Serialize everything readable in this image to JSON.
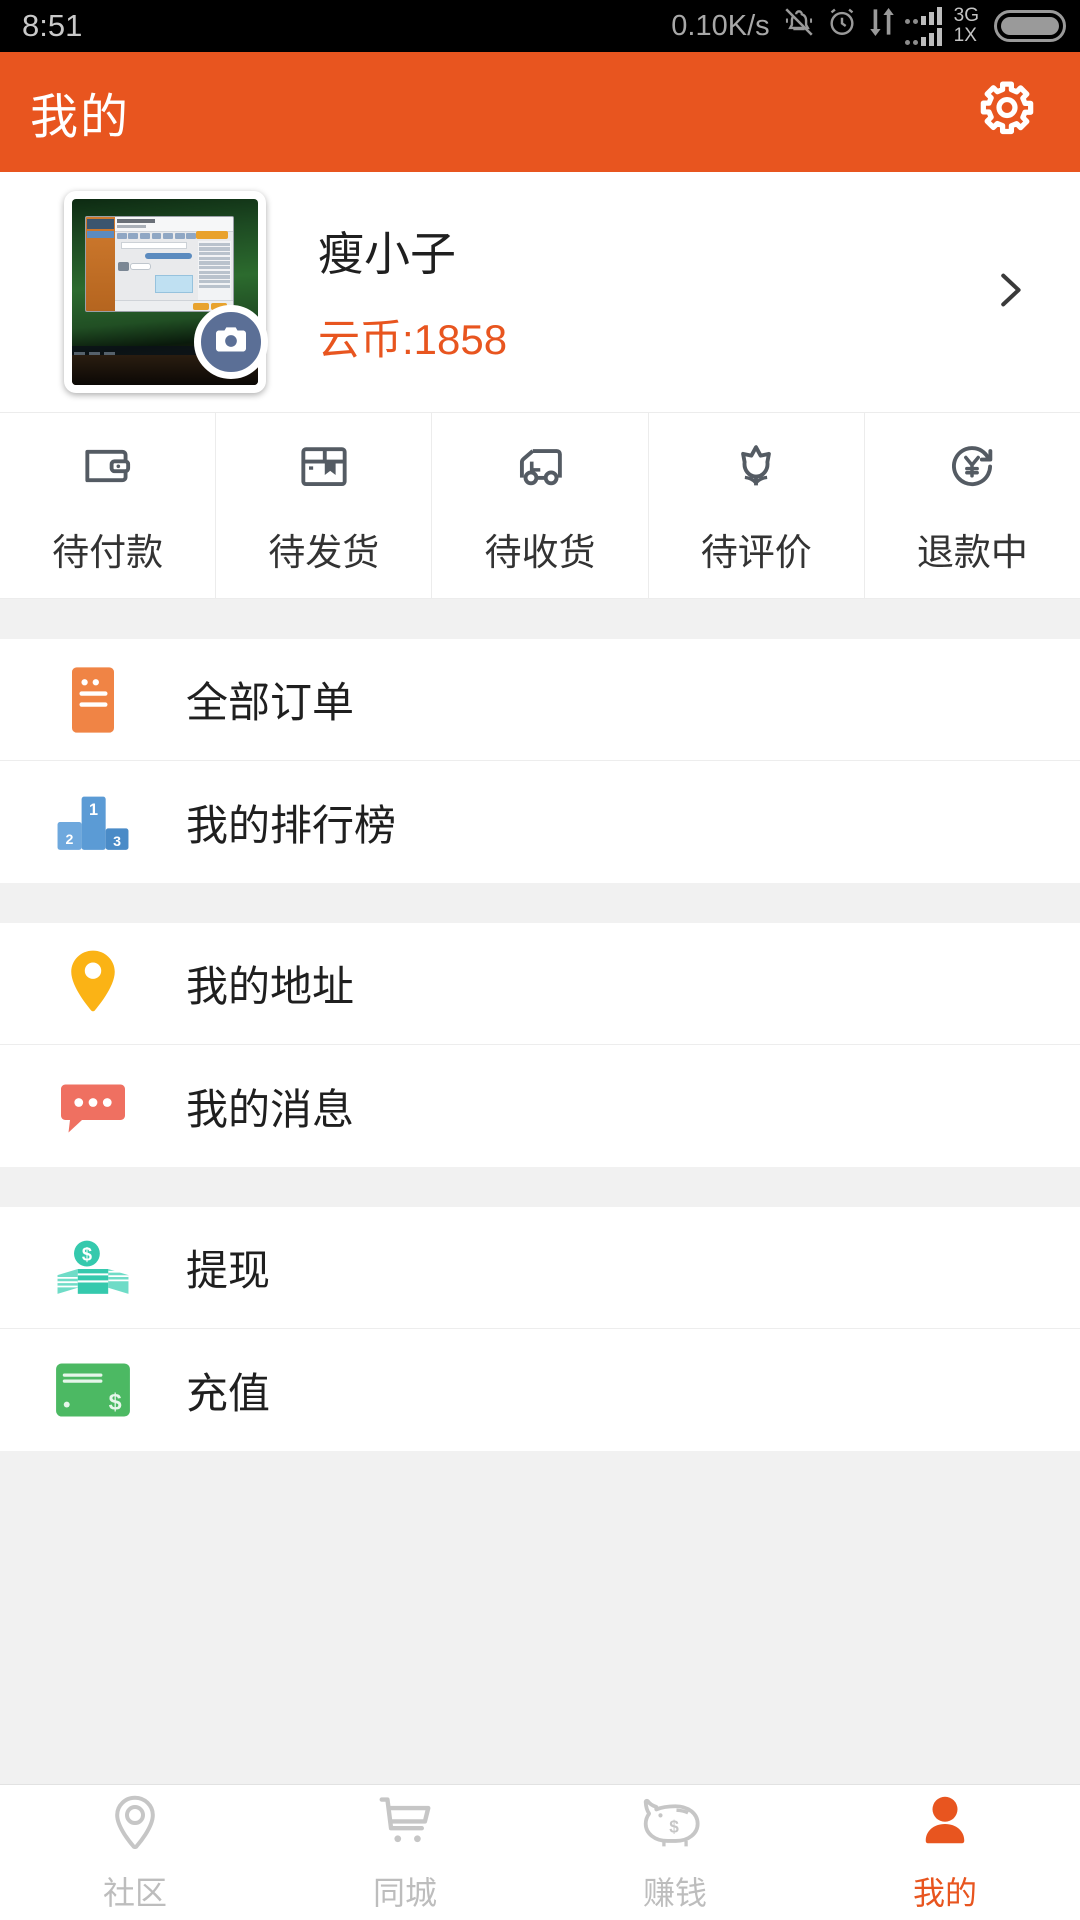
{
  "status_bar": {
    "time": "8:51",
    "network_speed": "0.10K/s",
    "icons": [
      "bell-muted-icon",
      "alarm-clock-icon",
      "data-transfer-icon",
      "signal-bars-icon",
      "battery-icon"
    ],
    "signal_label_top": "3G",
    "signal_label_bottom": "1X"
  },
  "header": {
    "title": "我的",
    "settings_icon": "gear-icon",
    "background_color": "#e8551f"
  },
  "profile": {
    "avatar_icon": "user-avatar-photo",
    "camera_badge_icon": "camera-icon",
    "username": "瘦小子",
    "coin_label": "云币:1858",
    "coin_color": "#e8551f",
    "chevron_icon": "chevron-right-icon"
  },
  "order_status": [
    {
      "label": "待付款",
      "icon": "wallet-icon"
    },
    {
      "label": "待发货",
      "icon": "package-box-icon"
    },
    {
      "label": "待收货",
      "icon": "delivery-truck-icon"
    },
    {
      "label": "待评价",
      "icon": "flower-icon"
    },
    {
      "label": "退款中",
      "icon": "refund-yuan-icon"
    }
  ],
  "menu_groups": [
    {
      "items": [
        {
          "label": "全部订单",
          "icon": "order-document-icon",
          "color": "#f08445"
        },
        {
          "label": "我的排行榜",
          "icon": "podium-ranking-icon",
          "color": "#5b9bd5"
        }
      ]
    },
    {
      "items": [
        {
          "label": "我的地址",
          "icon": "location-pin-icon",
          "color": "#fbb315"
        },
        {
          "label": "我的消息",
          "icon": "message-bubble-icon",
          "color": "#ef7061"
        }
      ]
    },
    {
      "items": [
        {
          "label": "提现",
          "icon": "cash-stack-icon",
          "color": "#35c9ad"
        },
        {
          "label": "充值",
          "icon": "credit-card-icon",
          "color": "#4cb963"
        }
      ]
    }
  ],
  "bottom_nav": {
    "active_color": "#e8551f",
    "inactive_color": "#bdbdbd",
    "items": [
      {
        "label": "社区",
        "icon": "location-pin-outline-icon",
        "active": false
      },
      {
        "label": "同城",
        "icon": "shopping-cart-icon",
        "active": false
      },
      {
        "label": "赚钱",
        "icon": "piggy-bank-icon",
        "active": false
      },
      {
        "label": "我的",
        "icon": "person-icon",
        "active": true
      }
    ]
  }
}
